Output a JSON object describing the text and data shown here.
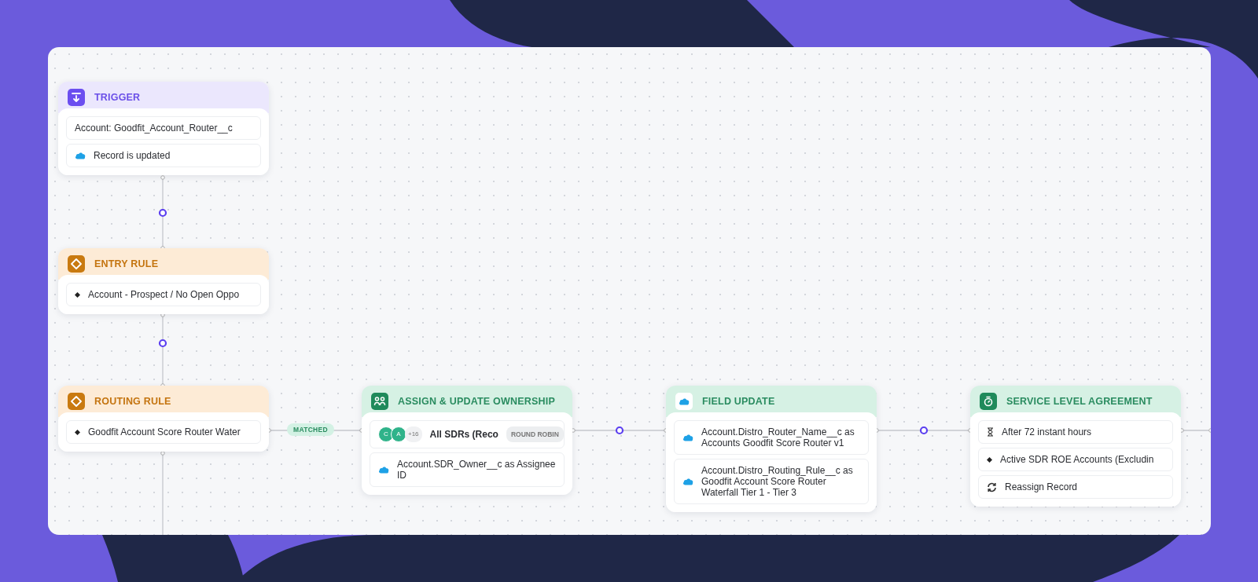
{
  "nodes": [
    {
      "kind": "trigger",
      "title": "TRIGGER",
      "rows": [
        {
          "kind": "text",
          "text": "Account: Goodfit_Account_Router__c"
        },
        {
          "kind": "salesforce",
          "text": "Record is updated"
        }
      ]
    },
    {
      "kind": "entry_rule",
      "title": "ENTRY RULE",
      "rows": [
        {
          "kind": "condition",
          "text": "Account - Prospect / No Open Oppo"
        }
      ]
    },
    {
      "kind": "routing_rule",
      "title": "ROUTING RULE",
      "rows": [
        {
          "kind": "condition",
          "text": "Goodfit Account Score Router Water"
        }
      ]
    },
    {
      "kind": "assign",
      "title": "ASSIGN & UPDATE OWNERSHIP",
      "rows": [
        {
          "kind": "assignees",
          "avatars": [
            "C",
            "A"
          ],
          "more": "+16",
          "text": "All SDRs (Reco",
          "badge": "ROUND ROBIN"
        },
        {
          "kind": "salesforce",
          "text": "Account.SDR_Owner__c as Assignee ID"
        }
      ]
    },
    {
      "kind": "field_update",
      "title": "FIELD UPDATE",
      "rows": [
        {
          "kind": "salesforce",
          "text": "Account.Distro_Router_Name__c as Accounts Goodfit Score Router v1"
        },
        {
          "kind": "salesforce",
          "text": "Account.Distro_Routing_Rule__c as Goodfit Account Score Router Waterfall Tier 1 - Tier 3"
        }
      ]
    },
    {
      "kind": "sla",
      "title": "SERVICE LEVEL AGREEMENT",
      "rows": [
        {
          "kind": "timer",
          "text": "After 72 instant hours"
        },
        {
          "kind": "condition",
          "text": "Active SDR ROE Accounts (Excludin"
        },
        {
          "kind": "action",
          "text": "Reassign Record"
        }
      ]
    }
  ],
  "branch_label": "MATCHED"
}
